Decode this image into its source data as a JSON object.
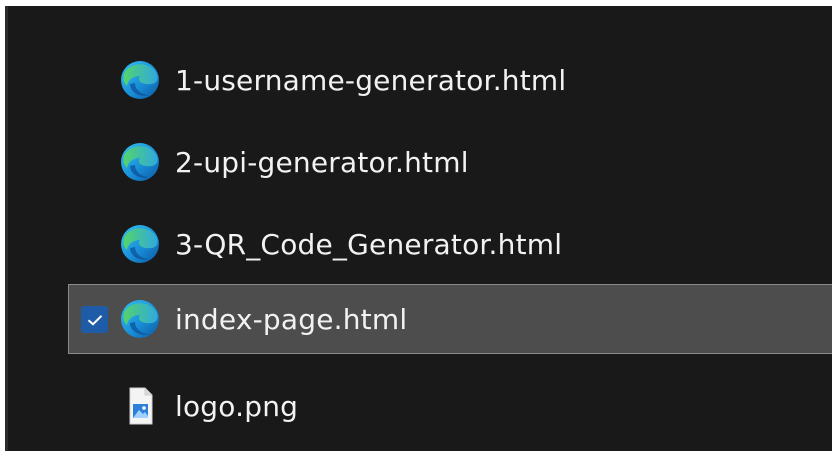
{
  "files": [
    {
      "name": "1-username-generator.html",
      "icon": "edge-icon",
      "selected": false
    },
    {
      "name": "2-upi-generator.html",
      "icon": "edge-icon",
      "selected": false
    },
    {
      "name": "3-QR_Code_Generator.html",
      "icon": "edge-icon",
      "selected": false
    },
    {
      "name": "index-page.html",
      "icon": "edge-icon",
      "selected": true
    },
    {
      "name": "logo.png",
      "icon": "png-image-icon",
      "selected": false
    }
  ],
  "colors": {
    "background": "#191919",
    "selected_row": "#4d4d4d",
    "checkbox": "#1f5ca8",
    "text": "#f2f2f2"
  }
}
